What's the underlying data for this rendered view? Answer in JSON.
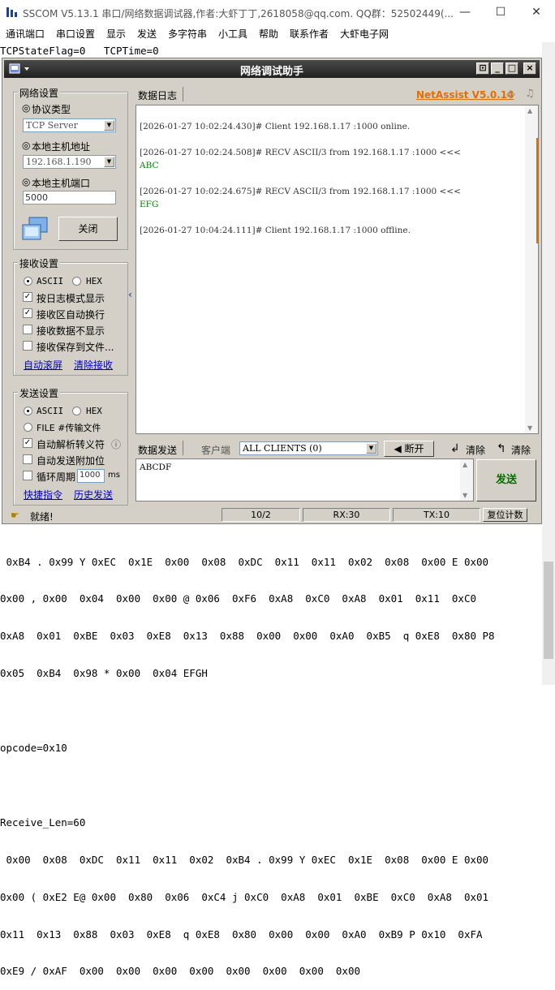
{
  "app": {
    "title": "SSCOM V5.13.1 串口/网络数据调试器,作者:大虾丁丁,2618058@qq.com. QQ群：52502449(...",
    "min": "—",
    "max": "☐",
    "close": "✕"
  },
  "menu": [
    "通讯端口",
    "串口设置",
    "显示",
    "发送",
    "多字符串",
    "小工具",
    "帮助",
    "联系作者",
    "大虾电子网"
  ],
  "terminal_top": "TCPStateFlag=0   TCPTime=0",
  "terminal_bottom": [
    " 0xB4 . 0x99 Y 0xEC  0x1E  0x00  0x08  0xDC  0x11  0x11  0x02  0x08  0x00 E 0x00",
    "0x00 , 0x00  0x04  0x00  0x00 @ 0x06  0xF6  0xA8  0xC0  0xA8  0x01  0x11  0xC0",
    "0xA8  0x01  0xBE  0x03  0xE8  0x13  0x88  0x00  0x00  0xA0  0xB5  q 0xE8  0x80 P8",
    "0x05  0xB4  0x98 * 0x00  0x04 EFGH",
    "",
    "opcode=0x10",
    "",
    "Receive_Len=60",
    " 0x00  0x08  0xDC  0x11  0x11  0x02  0xB4 . 0x99 Y 0xEC  0x1E  0x08  0x00 E 0x00",
    "0x00 ( 0xE2 E@ 0x00  0x80  0x06  0xC4 j 0xC0  0xA8  0x01  0xBE  0xC0  0xA8  0x01",
    "0x11  0x13  0x88  0x03  0xE8  q 0xE8  0x80  0x00  0x00  0xA0  0xB9 P 0x10  0xFA",
    "0xE9 / 0xAF  0x00  0x00  0x00  0x00  0x00  0x00  0x00  0x00"
  ],
  "netassist": {
    "title": "网络调试助手",
    "btn_pin": "⊡",
    "btn_min": "_",
    "btn_max": "□",
    "btn_close": "×",
    "brand": "NetAssist V5.0.14",
    "net_settings": {
      "label": "网络设置",
      "protocol_label": "协议类型",
      "protocol_value": "TCP Server",
      "host_label": "本地主机地址",
      "host_value": "192.168.1.190",
      "port_label": "本地主机端口",
      "port_value": "5000",
      "close_button": "关闭"
    },
    "recv_settings": {
      "label": "接收设置",
      "ascii": "ASCII",
      "hex": "HEX",
      "opt1": "按日志模式显示",
      "opt2": "接收区自动换行",
      "opt3": "接收数据不显示",
      "opt4": "接收保存到文件...",
      "link1": "自动滚屏",
      "link2": "清除接收"
    },
    "send_settings": {
      "label": "发送设置",
      "ascii": "ASCII",
      "hex": "HEX",
      "file": "FILE #传输文件",
      "opt1": "自动解析转义符",
      "opt2": "自动发送附加位",
      "opt3": "循环周期",
      "period_value": "1000",
      "period_unit": "ms",
      "link1": "快捷指令",
      "link2": "历史发送"
    },
    "log_tab": "数据日志",
    "log": [
      {
        "line": "[2026-01-27 10:02:24.430]# Client 192.168.1.17 :1000 online.",
        "data": ""
      },
      {
        "line": "[2026-01-27 10:02:24.508]# RECV ASCII/3 from 192.168.1.17 :1000 <<<",
        "data": "ABC"
      },
      {
        "line": "[2026-01-27 10:02:24.675]# RECV ASCII/3 from 192.168.1.17 :1000 <<<",
        "data": "EFG"
      },
      {
        "line": "[2026-01-27 10:04:24.111]# Client 192.168.1.17 :1000 offline.",
        "data": ""
      }
    ],
    "send_bar": {
      "tab": "数据发送",
      "client_label": "客户端",
      "client_value": "ALL CLIENTS (0)",
      "disconnect": "断开",
      "clear1": "清除",
      "clear2": "清除"
    },
    "send_text": "ABCDF",
    "send_button": "发送",
    "status": {
      "ready": "就绪!",
      "count": "10/2",
      "rx": "RX:30",
      "tx": "TX:10",
      "reset": "复位计数"
    }
  },
  "colors": {
    "brand": "#e07000",
    "send": "#007000",
    "log_data": "#008000",
    "title_bg": "#2a2a2a"
  }
}
